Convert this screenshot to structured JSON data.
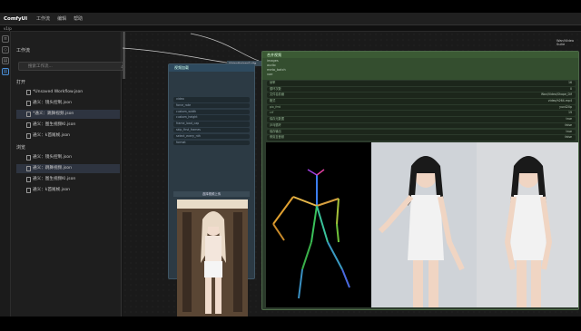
{
  "app": {
    "name": "ComfyUI",
    "menus": [
      "工作流",
      "编辑",
      "帮助"
    ]
  },
  "tab": {
    "label": "v1/p"
  },
  "sidebar": {
    "title": "工作流",
    "search_placeholder": "搜索工作流...",
    "open_section": "打开",
    "open_items": [
      "*Unsaved Workflow.json",
      "通义：镜头控制.json",
      "*通义：跳舞视频.json",
      "通义：图生视频Kl.json",
      "通义：k首尾帧.json"
    ],
    "browse_section": "浏览",
    "browse_items": [
      "通义：镜头控制.json",
      "通义：跳舞视频.json",
      "通义：图生视频Kl.json",
      "通义：k首尾帧.json"
    ]
  },
  "node_video": {
    "title": "视频加载",
    "tag": "VideoHelperSuite",
    "rows": [
      "video",
      "force_rate",
      "custom_width",
      "custom_height",
      "frame_load_cap",
      "skip_first_frames",
      "select_every_nth",
      "format"
    ],
    "button": "选择视频上传"
  },
  "node_out": {
    "title": "合并视频",
    "tag": "VideoHelperSuite",
    "sub": [
      "images",
      "audio",
      "meta_batch",
      "vae"
    ],
    "rows": [
      {
        "k": "帧率",
        "v": "16"
      },
      {
        "k": "循环次数",
        "v": "0"
      },
      {
        "k": "文件名前缀",
        "v": "Wan/Video/Shape_Dif"
      },
      {
        "k": "格式",
        "v": "video/h264-mp4"
      },
      {
        "k": "pix_fmt",
        "v": "yuv420p"
      },
      {
        "k": "crf",
        "v": "19"
      },
      {
        "k": "保存元数据",
        "v": "true"
      },
      {
        "k": "乒乓循环",
        "v": "false"
      },
      {
        "k": "保存输出",
        "v": "true"
      },
      {
        "k": "修剪至音频",
        "v": "false"
      }
    ]
  },
  "canvas": {
    "zoom_label": "Wan/Video Suite"
  },
  "colors": {
    "accent": "#4a8fd8",
    "node_green": "#3b5a34",
    "node_blue": "#2e4a5e"
  }
}
